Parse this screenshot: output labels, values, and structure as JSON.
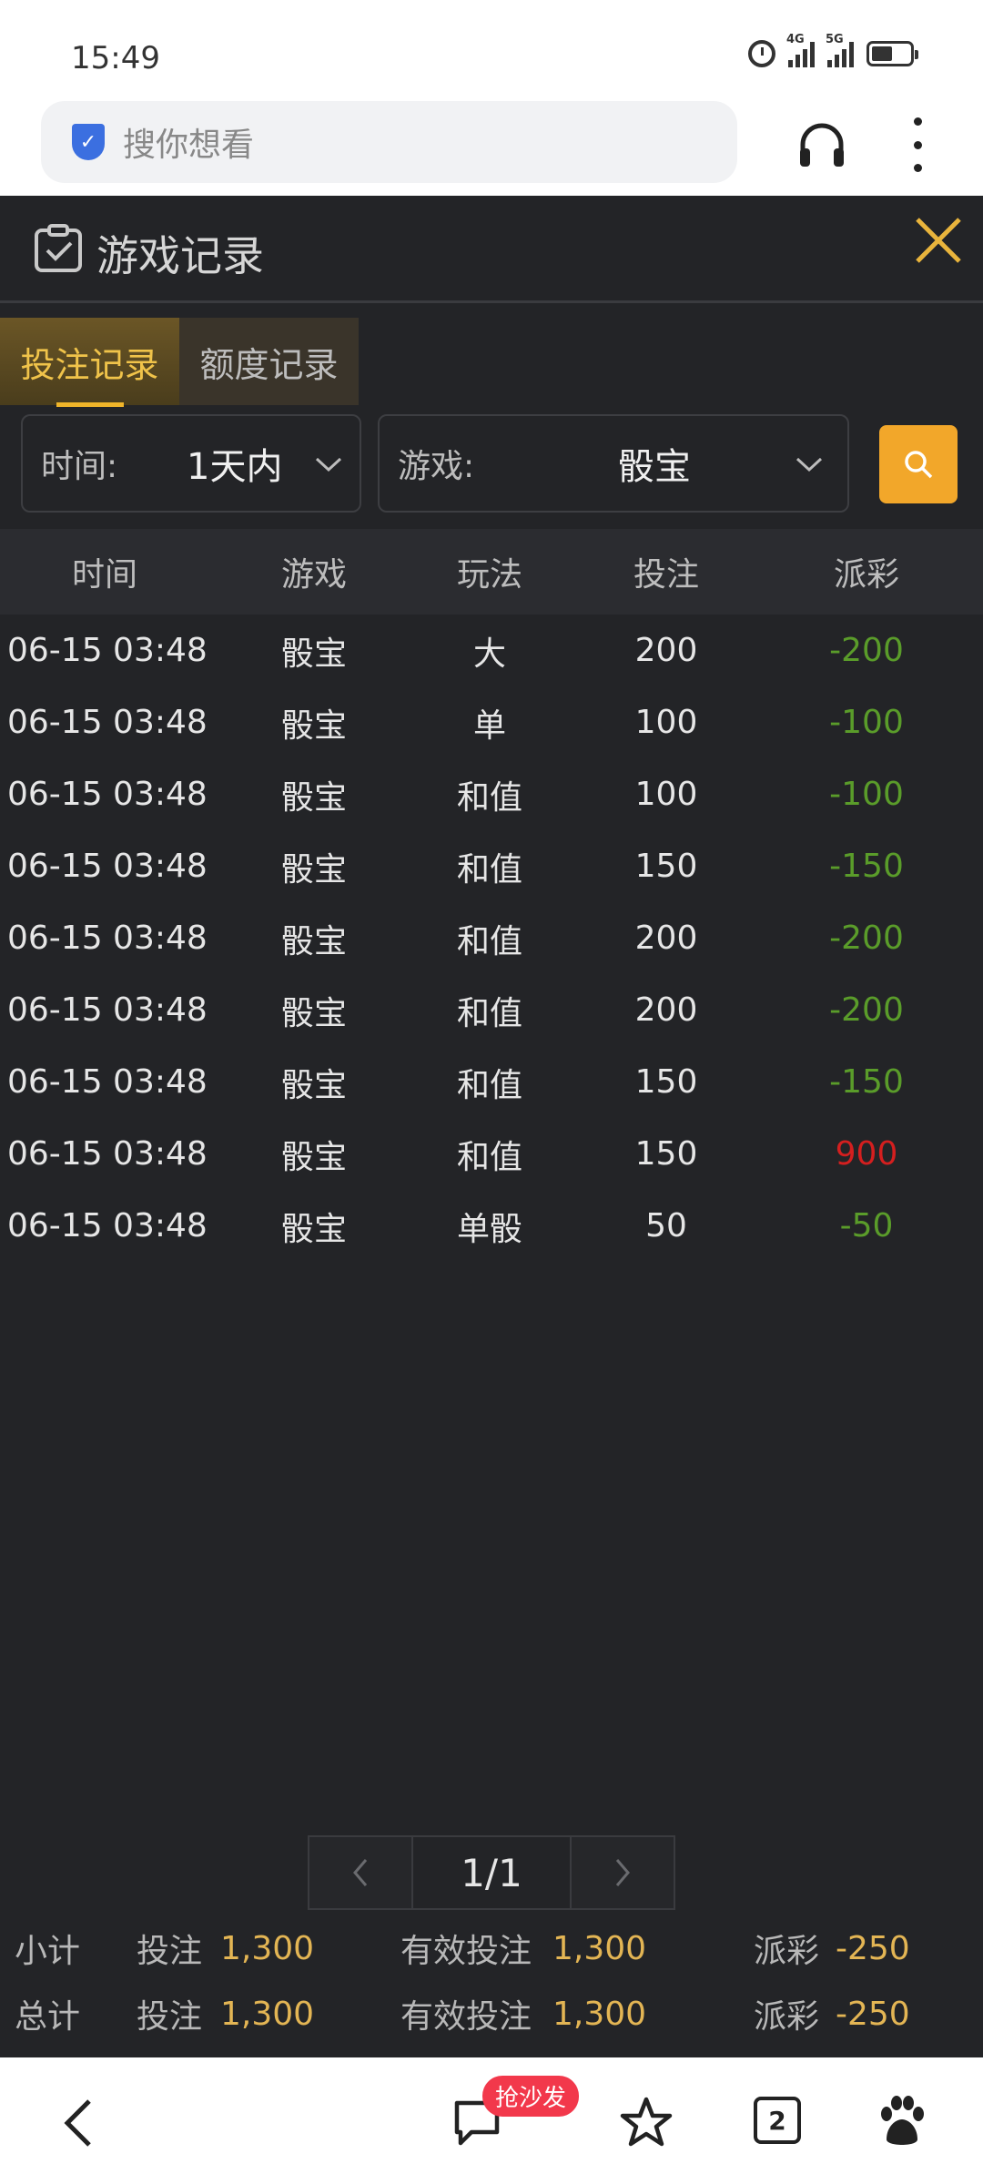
{
  "status_bar": {
    "time": "15:49",
    "net1": "4G",
    "net2": "5G"
  },
  "browser": {
    "search_placeholder": "搜你想看"
  },
  "panel": {
    "title": "游戏记录",
    "tabs": [
      {
        "label": "投注记录",
        "active": true
      },
      {
        "label": "额度记录",
        "active": false
      }
    ],
    "filters": {
      "time_label": "时间:",
      "time_value": "1天内",
      "game_label": "游戏:",
      "game_value": "骰宝"
    },
    "table": {
      "headers": [
        "时间",
        "游戏",
        "玩法",
        "投注",
        "派彩"
      ],
      "rows": [
        {
          "time": "06-15 03:48",
          "game": "骰宝",
          "play": "大",
          "bet": "200",
          "payout": "-200"
        },
        {
          "time": "06-15 03:48",
          "game": "骰宝",
          "play": "单",
          "bet": "100",
          "payout": "-100"
        },
        {
          "time": "06-15 03:48",
          "game": "骰宝",
          "play": "和值",
          "bet": "100",
          "payout": "-100"
        },
        {
          "time": "06-15 03:48",
          "game": "骰宝",
          "play": "和值",
          "bet": "150",
          "payout": "-150"
        },
        {
          "time": "06-15 03:48",
          "game": "骰宝",
          "play": "和值",
          "bet": "200",
          "payout": "-200"
        },
        {
          "time": "06-15 03:48",
          "game": "骰宝",
          "play": "和值",
          "bet": "200",
          "payout": "-200"
        },
        {
          "time": "06-15 03:48",
          "game": "骰宝",
          "play": "和值",
          "bet": "150",
          "payout": "-150"
        },
        {
          "time": "06-15 03:48",
          "game": "骰宝",
          "play": "和值",
          "bet": "150",
          "payout": "900"
        },
        {
          "time": "06-15 03:48",
          "game": "骰宝",
          "play": "单骰",
          "bet": "50",
          "payout": "-50"
        }
      ]
    },
    "pagination": {
      "page": "1/1"
    },
    "subtotal": {
      "label": "小计",
      "bet_label": "投注",
      "bet": "1,300",
      "valid_label": "有效投注",
      "valid": "1,300",
      "payout_label": "派彩",
      "payout": "-250"
    },
    "total": {
      "label": "总计",
      "bet_label": "投注",
      "bet": "1,300",
      "valid_label": "有效投注",
      "valid": "1,300",
      "payout_label": "派彩",
      "payout": "-250"
    }
  },
  "bottom_nav": {
    "badge": "抢沙发",
    "tab_count": "2"
  },
  "colors": {
    "accent": "#f2a72a",
    "panel_bg": "#232427",
    "loss": "#5a9c2a",
    "win": "#d41f1f",
    "sum_value": "#e3b554"
  }
}
